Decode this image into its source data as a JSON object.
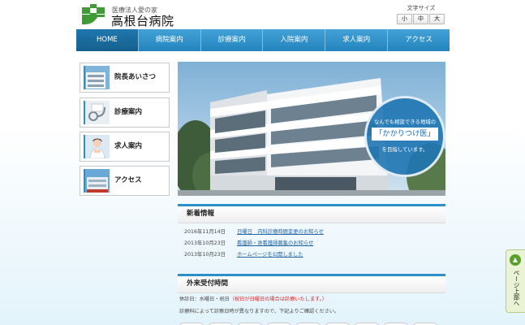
{
  "header": {
    "logo_sub": "医療法人愛の家",
    "logo_main": "高根台病院",
    "font_size": {
      "label": "文字サイズ",
      "small": "小",
      "medium": "中",
      "large": "大"
    }
  },
  "nav": {
    "items": [
      {
        "label": "HOME",
        "active": true
      },
      {
        "label": "病院案内"
      },
      {
        "label": "診療案内"
      },
      {
        "label": "入院案内"
      },
      {
        "label": "求人案内"
      },
      {
        "label": "アクセス"
      }
    ]
  },
  "sidebar": {
    "items": [
      {
        "label": "院長あいさつ",
        "icon": "building-photo-icon"
      },
      {
        "label": "診療案内",
        "icon": "stethoscope-photo-icon"
      },
      {
        "label": "求人案内",
        "icon": "nurse-photo-icon"
      },
      {
        "label": "アクセス",
        "icon": "map-photo-icon"
      }
    ]
  },
  "hero": {
    "line1": "なんでも相談できる地域の",
    "line2": "「かかりつけ医」",
    "line3": "を目指しています。"
  },
  "news": {
    "title": "新着情報",
    "items": [
      {
        "date": "2016年11月14日",
        "text": "日曜日　内科診療時間変更のお知らせ"
      },
      {
        "date": "2013年10月23日",
        "text": "看護師・准看護師募集のお知らせ"
      },
      {
        "date": "2013年10月23日",
        "text": "ホームページを公開しました"
      }
    ]
  },
  "hours": {
    "title": "外来受付時間",
    "closed_label": "休診日：水曜日・祝日",
    "closed_note": "（祝日が日曜日の場合は診療いたします。）",
    "note": "診療科によって診察日時が異なりますので、下記よりご確認ください。"
  },
  "page_top": {
    "label": "ページ上部へ"
  },
  "colors": {
    "nav_blue": "#2d8fc7",
    "link_blue": "#2466a6",
    "alert_red": "#d22222",
    "pagetop_green": "#5aa02c"
  }
}
